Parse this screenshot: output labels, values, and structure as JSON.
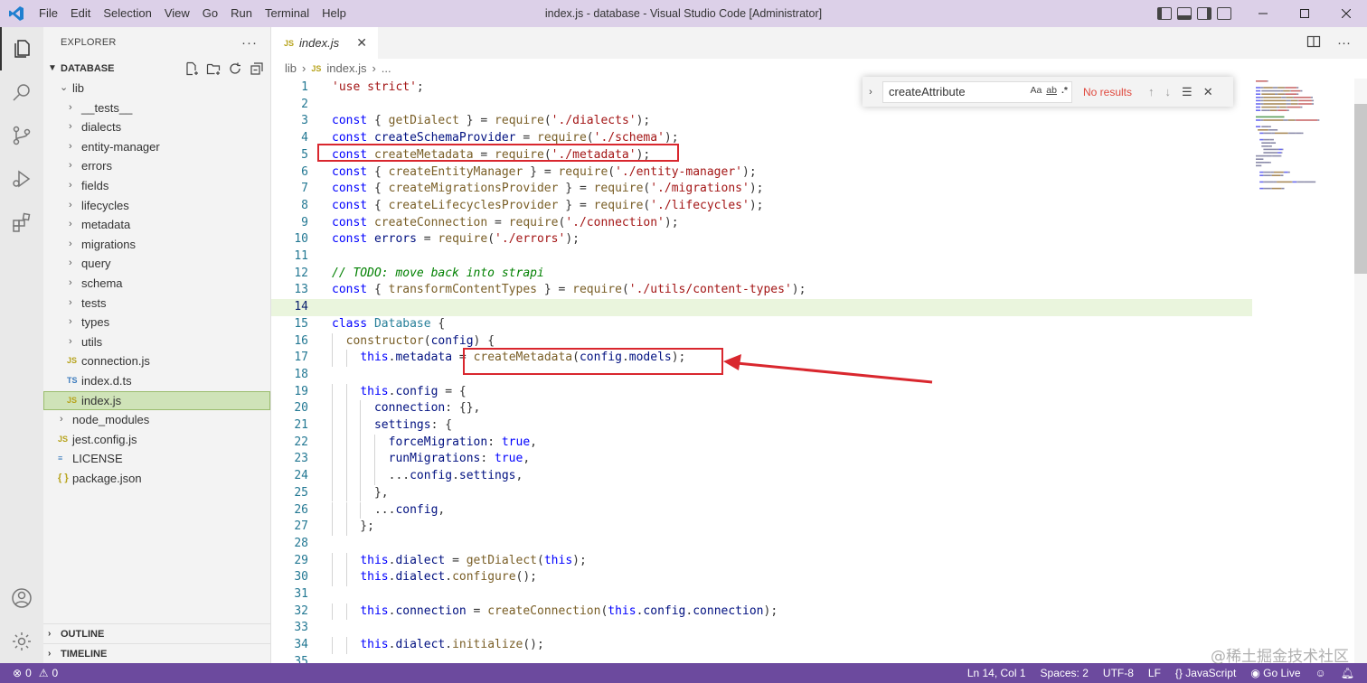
{
  "window": {
    "title": "index.js - database - Visual Studio Code [Administrator]",
    "menu": [
      "File",
      "Edit",
      "Selection",
      "View",
      "Go",
      "Run",
      "Terminal",
      "Help"
    ]
  },
  "sidebar": {
    "title": "EXPLORER",
    "root": "DATABASE",
    "tree": [
      {
        "label": "lib",
        "type": "folder-open",
        "depth": 1
      },
      {
        "label": "__tests__",
        "type": "folder",
        "depth": 2
      },
      {
        "label": "dialects",
        "type": "folder",
        "depth": 2
      },
      {
        "label": "entity-manager",
        "type": "folder",
        "depth": 2
      },
      {
        "label": "errors",
        "type": "folder",
        "depth": 2
      },
      {
        "label": "fields",
        "type": "folder",
        "depth": 2
      },
      {
        "label": "lifecycles",
        "type": "folder",
        "depth": 2
      },
      {
        "label": "metadata",
        "type": "folder",
        "depth": 2
      },
      {
        "label": "migrations",
        "type": "folder",
        "depth": 2
      },
      {
        "label": "query",
        "type": "folder",
        "depth": 2
      },
      {
        "label": "schema",
        "type": "folder",
        "depth": 2
      },
      {
        "label": "tests",
        "type": "folder",
        "depth": 2
      },
      {
        "label": "types",
        "type": "folder",
        "depth": 2
      },
      {
        "label": "utils",
        "type": "folder",
        "depth": 2
      },
      {
        "label": "connection.js",
        "type": "js",
        "depth": 2
      },
      {
        "label": "index.d.ts",
        "type": "ts",
        "depth": 2
      },
      {
        "label": "index.js",
        "type": "js",
        "depth": 2,
        "selected": true
      },
      {
        "label": "node_modules",
        "type": "folder",
        "depth": 1
      },
      {
        "label": "jest.config.js",
        "type": "js",
        "depth": 1
      },
      {
        "label": "LICENSE",
        "type": "license",
        "depth": 1
      },
      {
        "label": "package.json",
        "type": "json",
        "depth": 1
      }
    ],
    "outline": "OUTLINE",
    "timeline": "TIMELINE"
  },
  "editor": {
    "tab_name": "index.js",
    "breadcrumb": [
      "lib",
      "index.js",
      "..."
    ],
    "find": {
      "query": "createAttribute",
      "result": "No results",
      "opts": [
        "Aa",
        "ab",
        ".*"
      ]
    },
    "current_line": 14,
    "lines": [
      {
        "n": "1",
        "t": [
          [
            "str",
            "'use strict'"
          ],
          [
            "",
            ";"
          ]
        ]
      },
      {
        "n": "2",
        "t": []
      },
      {
        "n": "3",
        "t": [
          [
            "kw",
            "const"
          ],
          [
            "",
            " { "
          ],
          [
            "fn",
            "getDialect"
          ],
          [
            "",
            " } = "
          ],
          [
            "fn",
            "require"
          ],
          [
            "",
            "("
          ],
          [
            "str",
            "'./dialects'"
          ],
          [
            "",
            ");"
          ]
        ]
      },
      {
        "n": "4",
        "t": [
          [
            "kw",
            "const"
          ],
          [
            "",
            " "
          ],
          [
            "var",
            "createSchemaProvider"
          ],
          [
            "",
            " = "
          ],
          [
            "fn",
            "require"
          ],
          [
            "",
            "("
          ],
          [
            "str",
            "'./schema'"
          ],
          [
            "",
            ");"
          ]
        ]
      },
      {
        "n": "5",
        "t": [
          [
            "kw",
            "const"
          ],
          [
            "",
            " "
          ],
          [
            "fn",
            "createMetadata"
          ],
          [
            "",
            " = "
          ],
          [
            "fn",
            "require"
          ],
          [
            "",
            "("
          ],
          [
            "str",
            "'./metadata'"
          ],
          [
            "",
            ");"
          ]
        ]
      },
      {
        "n": "6",
        "t": [
          [
            "kw",
            "const"
          ],
          [
            "",
            " { "
          ],
          [
            "fn",
            "createEntityManager"
          ],
          [
            "",
            " } = "
          ],
          [
            "fn",
            "require"
          ],
          [
            "",
            "("
          ],
          [
            "str",
            "'./entity-manager'"
          ],
          [
            "",
            ");"
          ]
        ]
      },
      {
        "n": "7",
        "t": [
          [
            "kw",
            "const"
          ],
          [
            "",
            " { "
          ],
          [
            "fn",
            "createMigrationsProvider"
          ],
          [
            "",
            " } = "
          ],
          [
            "fn",
            "require"
          ],
          [
            "",
            "("
          ],
          [
            "str",
            "'./migrations'"
          ],
          [
            "",
            ");"
          ]
        ]
      },
      {
        "n": "8",
        "t": [
          [
            "kw",
            "const"
          ],
          [
            "",
            " { "
          ],
          [
            "fn",
            "createLifecyclesProvider"
          ],
          [
            "",
            " } = "
          ],
          [
            "fn",
            "require"
          ],
          [
            "",
            "("
          ],
          [
            "str",
            "'./lifecycles'"
          ],
          [
            "",
            ");"
          ]
        ]
      },
      {
        "n": "9",
        "t": [
          [
            "kw",
            "const"
          ],
          [
            "",
            " "
          ],
          [
            "fn",
            "createConnection"
          ],
          [
            "",
            " = "
          ],
          [
            "fn",
            "require"
          ],
          [
            "",
            "("
          ],
          [
            "str",
            "'./connection'"
          ],
          [
            "",
            ");"
          ]
        ]
      },
      {
        "n": "10",
        "t": [
          [
            "kw",
            "const"
          ],
          [
            "",
            " "
          ],
          [
            "var",
            "errors"
          ],
          [
            "",
            " = "
          ],
          [
            "fn",
            "require"
          ],
          [
            "",
            "("
          ],
          [
            "str",
            "'./errors'"
          ],
          [
            "",
            ");"
          ]
        ]
      },
      {
        "n": "11",
        "t": []
      },
      {
        "n": "12",
        "t": [
          [
            "cmt",
            "// TODO: move back into strapi"
          ]
        ]
      },
      {
        "n": "13",
        "t": [
          [
            "kw",
            "const"
          ],
          [
            "",
            " { "
          ],
          [
            "fn",
            "transformContentTypes"
          ],
          [
            "",
            " } = "
          ],
          [
            "fn",
            "require"
          ],
          [
            "",
            "("
          ],
          [
            "str",
            "'./utils/content-types'"
          ],
          [
            "",
            ");"
          ]
        ]
      },
      {
        "n": "14",
        "t": []
      },
      {
        "n": "15",
        "t": [
          [
            "kw",
            "class"
          ],
          [
            "",
            " "
          ],
          [
            "cls",
            "Database"
          ],
          [
            "",
            " {"
          ]
        ]
      },
      {
        "n": "16",
        "t": [
          [
            "",
            "  "
          ],
          [
            "fn",
            "constructor"
          ],
          [
            "",
            "("
          ],
          [
            "var",
            "config"
          ],
          [
            "",
            ") {"
          ]
        ]
      },
      {
        "n": "17",
        "t": [
          [
            "",
            "    "
          ],
          [
            "kw",
            "this"
          ],
          [
            "",
            "."
          ],
          [
            "var",
            "metadata"
          ],
          [
            "",
            " = "
          ],
          [
            "fn",
            "createMetadata"
          ],
          [
            "",
            "("
          ],
          [
            "var",
            "config"
          ],
          [
            "",
            "."
          ],
          [
            "var",
            "models"
          ],
          [
            "",
            ");"
          ]
        ]
      },
      {
        "n": "18",
        "t": []
      },
      {
        "n": "19",
        "t": [
          [
            "",
            "    "
          ],
          [
            "kw",
            "this"
          ],
          [
            "",
            "."
          ],
          [
            "var",
            "config"
          ],
          [
            "",
            " = {"
          ]
        ]
      },
      {
        "n": "20",
        "t": [
          [
            "",
            "      "
          ],
          [
            "var",
            "connection"
          ],
          [
            "",
            ": {},"
          ]
        ]
      },
      {
        "n": "21",
        "t": [
          [
            "",
            "      "
          ],
          [
            "var",
            "settings"
          ],
          [
            "",
            ": {"
          ]
        ]
      },
      {
        "n": "22",
        "t": [
          [
            "",
            "        "
          ],
          [
            "var",
            "forceMigration"
          ],
          [
            "",
            ": "
          ],
          [
            "kw",
            "true"
          ],
          [
            "",
            ","
          ]
        ]
      },
      {
        "n": "23",
        "t": [
          [
            "",
            "        "
          ],
          [
            "var",
            "runMigrations"
          ],
          [
            "",
            ": "
          ],
          [
            "kw",
            "true"
          ],
          [
            "",
            ","
          ]
        ]
      },
      {
        "n": "24",
        "t": [
          [
            "",
            "        ..."
          ],
          [
            "var",
            "config"
          ],
          [
            "",
            "."
          ],
          [
            "var",
            "settings"
          ],
          [
            "",
            ","
          ]
        ]
      },
      {
        "n": "25",
        "t": [
          [
            "",
            "      },"
          ]
        ]
      },
      {
        "n": "26",
        "t": [
          [
            "",
            "      ..."
          ],
          [
            "var",
            "config"
          ],
          [
            "",
            ","
          ]
        ]
      },
      {
        "n": "27",
        "t": [
          [
            "",
            "    };"
          ]
        ]
      },
      {
        "n": "28",
        "t": []
      },
      {
        "n": "29",
        "t": [
          [
            "",
            "    "
          ],
          [
            "kw",
            "this"
          ],
          [
            "",
            "."
          ],
          [
            "var",
            "dialect"
          ],
          [
            "",
            " = "
          ],
          [
            "fn",
            "getDialect"
          ],
          [
            "",
            "("
          ],
          [
            "kw",
            "this"
          ],
          [
            "",
            ");"
          ]
        ]
      },
      {
        "n": "30",
        "t": [
          [
            "",
            "    "
          ],
          [
            "kw",
            "this"
          ],
          [
            "",
            "."
          ],
          [
            "var",
            "dialect"
          ],
          [
            "",
            "."
          ],
          [
            "fn",
            "configure"
          ],
          [
            "",
            "();"
          ]
        ]
      },
      {
        "n": "31",
        "t": []
      },
      {
        "n": "32",
        "t": [
          [
            "",
            "    "
          ],
          [
            "kw",
            "this"
          ],
          [
            "",
            "."
          ],
          [
            "var",
            "connection"
          ],
          [
            "",
            " = "
          ],
          [
            "fn",
            "createConnection"
          ],
          [
            "",
            "("
          ],
          [
            "kw",
            "this"
          ],
          [
            "",
            "."
          ],
          [
            "var",
            "config"
          ],
          [
            "",
            "."
          ],
          [
            "var",
            "connection"
          ],
          [
            "",
            ");"
          ]
        ]
      },
      {
        "n": "33",
        "t": []
      },
      {
        "n": "34",
        "t": [
          [
            "",
            "    "
          ],
          [
            "kw",
            "this"
          ],
          [
            "",
            "."
          ],
          [
            "var",
            "dialect"
          ],
          [
            "",
            "."
          ],
          [
            "fn",
            "initialize"
          ],
          [
            "",
            "();"
          ]
        ]
      },
      {
        "n": "35",
        "t": []
      }
    ]
  },
  "statusbar": {
    "problems": "0",
    "warnings": "0",
    "position": "Ln 14, Col 1",
    "spaces": "Spaces: 2",
    "encoding": "UTF-8",
    "eol": "LF",
    "language": "JavaScript",
    "golive": "Go Live"
  },
  "watermark": "@稀土掘金技术社区",
  "colors": {
    "titlebar": "#dcd0e8",
    "statusbar": "#6c4a9e",
    "selected_row": "#cfe3b8",
    "annotation_red": "#d9272e"
  }
}
